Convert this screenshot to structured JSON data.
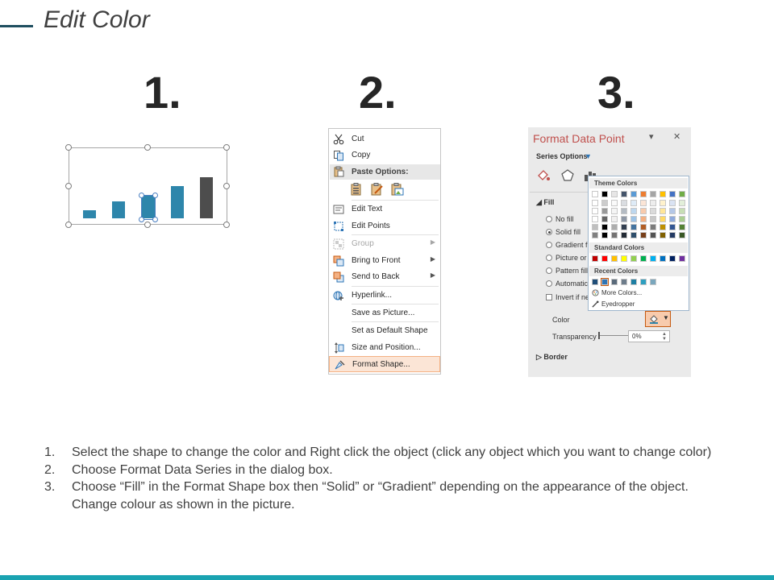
{
  "slide": {
    "title": "Edit Color",
    "step_numbers": [
      "1.",
      "2.",
      "3."
    ]
  },
  "context_menu": {
    "items": [
      {
        "label": "Cut",
        "icon": "scissors-icon"
      },
      {
        "label": "Copy",
        "icon": "copy-icon"
      },
      {
        "label": "Edit Text",
        "icon": "edit-text-icon"
      },
      {
        "label": "Edit Points",
        "icon": "edit-points-icon"
      },
      {
        "label": "Group",
        "icon": "group-icon",
        "disabled": true
      },
      {
        "label": "Bring to Front",
        "icon": "bring-to-front-icon"
      },
      {
        "label": "Send to Back",
        "icon": "send-to-back-icon"
      },
      {
        "label": "Hyperlink...",
        "icon": "hyperlink-icon"
      },
      {
        "label": "Save as Picture..."
      },
      {
        "label": "Set as Default Shape"
      },
      {
        "label": "Size and Position...",
        "icon": "size-position-icon"
      },
      {
        "label": "Format Shape...",
        "icon": "format-shape-icon",
        "highlighted": true
      }
    ],
    "paste_options_label": "Paste Options:"
  },
  "format_pane": {
    "title": "Format Data Point",
    "series_options_label": "Series Options",
    "fill_label": "Fill",
    "fill_options": [
      "No fill",
      "Solid fill",
      "Gradient fi",
      "Picture or",
      "Pattern fill",
      "Automatic"
    ],
    "invert_label": "Invert if ne",
    "color_label": "Color",
    "transparency_label": "Transparency",
    "transparency_value": "0%",
    "border_label": "Border",
    "close_glyph": "✕",
    "dropdown_glyph": "▾",
    "accent_color": "#c0504d"
  },
  "color_picker": {
    "theme_colors_label": "Theme Colors",
    "standard_colors_label": "Standard Colors",
    "recent_colors_label": "Recent Colors",
    "more_colors_label": "More Colors...",
    "eyedropper_label": "Eyedropper",
    "theme_base": [
      "#ffffff",
      "#000000",
      "#e7e6e6",
      "#44546a",
      "#5b9bd5",
      "#ed7d31",
      "#a5a5a5",
      "#ffc000",
      "#4472c4",
      "#70ad47"
    ],
    "standard": [
      "#c00000",
      "#ff0000",
      "#ffc000",
      "#ffff00",
      "#92d050",
      "#00b050",
      "#00b0f0",
      "#0070c0",
      "#002060",
      "#7030a0"
    ],
    "recent": [
      "#1f4e79",
      "#2e75b6",
      "#5a6b7b",
      "#6d7d8b",
      "#1e7fa3",
      "#2e9fc0",
      "#7aa7bd"
    ]
  },
  "instructions": [
    {
      "num": "1.",
      "text": "Select the shape to change the color and Right click the object (click any object which you want to change color)"
    },
    {
      "num": "2.",
      "text": "Choose Format Data Series in the dialog box."
    },
    {
      "num": "3.",
      "text": "Choose “Fill” in the Format Shape box then “Solid” or “Gradient” depending on the appearance of the object. Change colour as shown in the picture."
    }
  ],
  "colors": {
    "bar_teal": "#2e86ab",
    "bar_dark": "#4d4d4d",
    "bottom_bar": "#1aa3b1",
    "selection_blue": "#4a7fc1"
  }
}
